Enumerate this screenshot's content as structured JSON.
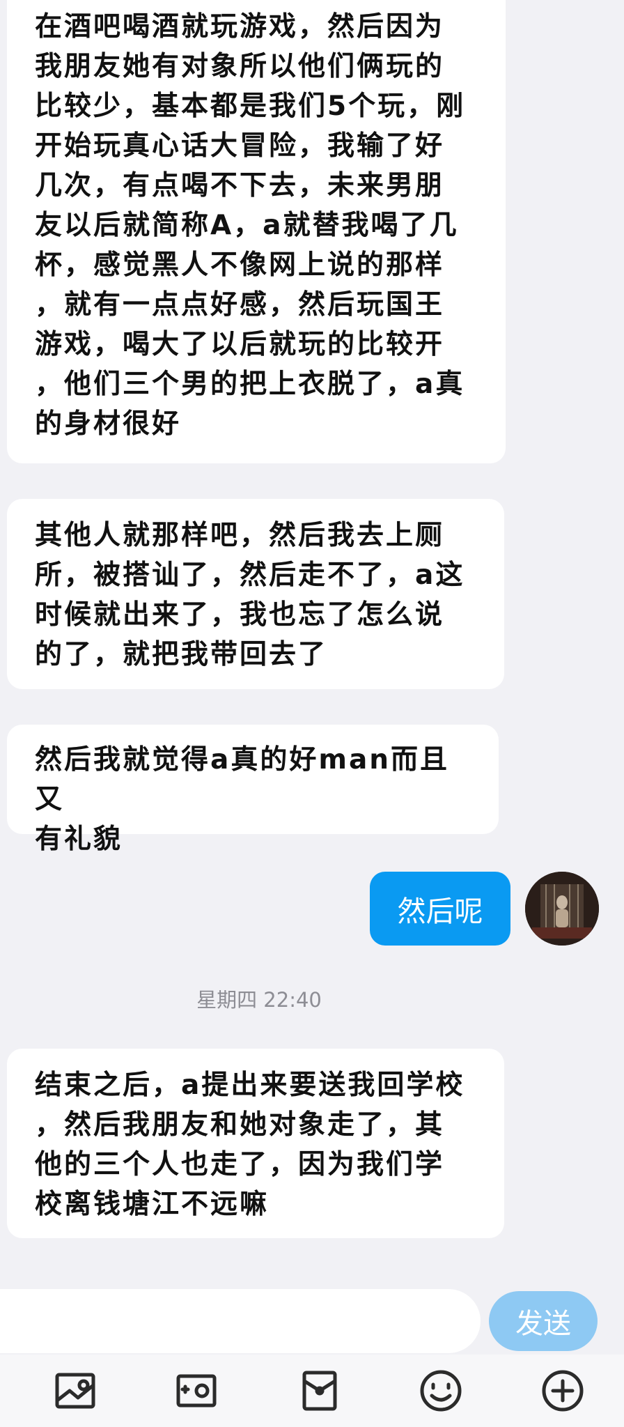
{
  "messages": {
    "incoming": [
      "在酒吧喝酒就玩游戏，然后因为\n我朋友她有对象所以他们俩玩的\n比较少，基本都是我们5个玩，刚\n开始玩真心话大冒险，我输了好\n几次，有点喝不下去，未来男朋\n友以后就简称A，a就替我喝了几\n杯，感觉黑人不像网上说的那样\n，就有一点点好感，然后玩国王\n游戏，喝大了以后就玩的比较开\n，他们三个男的把上衣脱了，a真\n的身材很好",
      "其他人就那样吧，然后我去上厕\n所，被搭讪了，然后走不了，a这\n时候就出来了，我也忘了怎么说\n的了，就把我带回去了",
      "然后我就觉得a真的好man而且又\n有礼貌",
      "结束之后，a提出来要送我回学校\n，然后我朋友和她对象走了，其\n他的三个人也走了，因为我们学\n校离钱塘江不远嘛"
    ],
    "outgoing": "然后呢",
    "timestamp": "星期四 22:40"
  },
  "input": {
    "value": "",
    "send_label": "发送"
  },
  "toolbar": {
    "icons": [
      "image-icon",
      "camera-icon",
      "red-packet-icon",
      "emoji-icon",
      "plus-icon"
    ]
  },
  "colors": {
    "background": "#f1f1f5",
    "outgoing_bubble": "#0a9af2",
    "send_button": "#8ec9f3",
    "icon": "#2b2b2b"
  }
}
